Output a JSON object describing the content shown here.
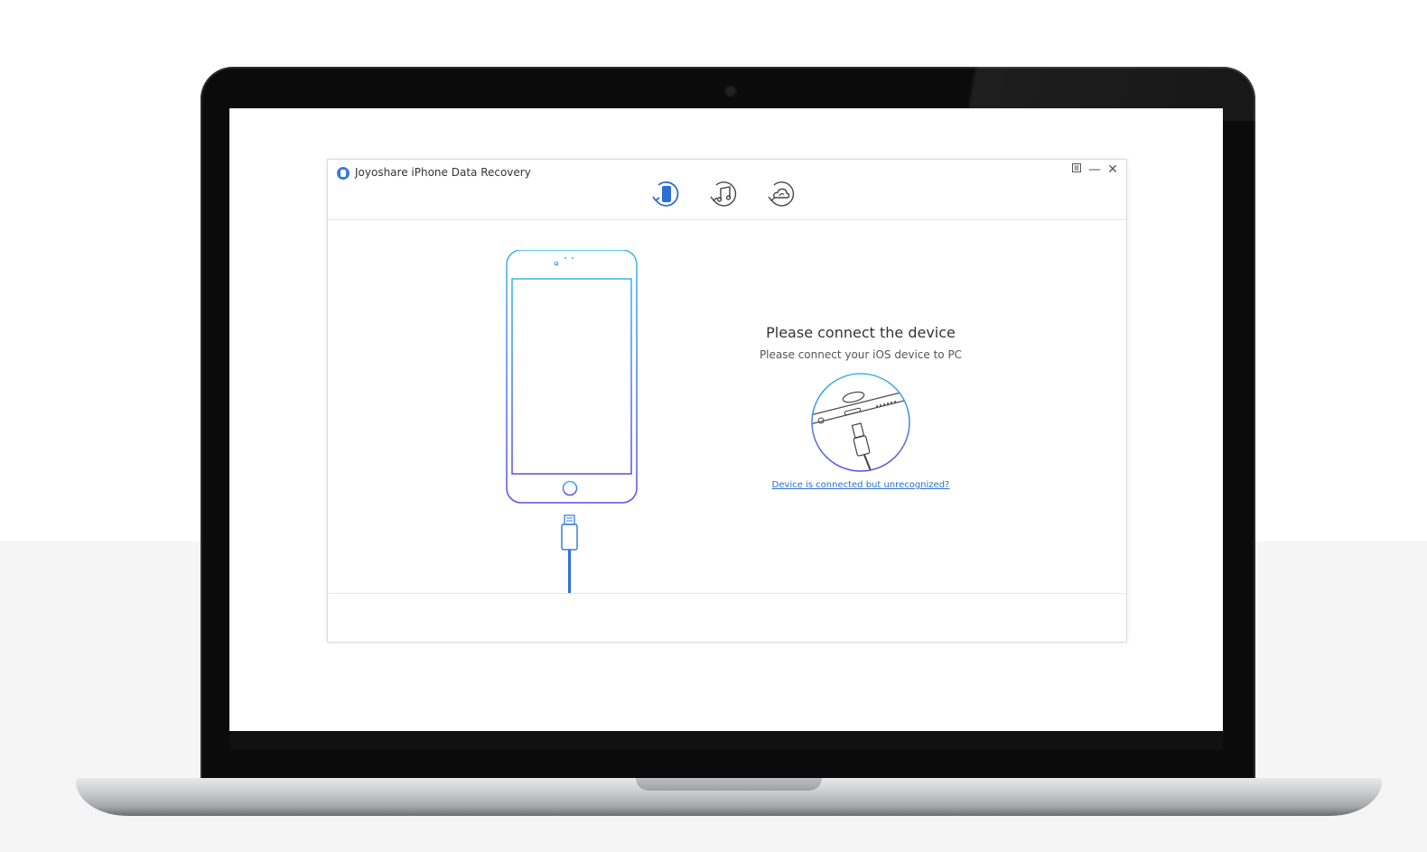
{
  "app": {
    "title": "Joyoshare iPhone Data Recovery"
  },
  "window_controls": {
    "menu_icon": "menu-icon",
    "minimize_label": "—",
    "close_label": "✕"
  },
  "mode_tabs": [
    {
      "name": "recover-from-ios-device",
      "icon": "iphone-restore-icon",
      "active": true
    },
    {
      "name": "recover-from-itunes",
      "icon": "itunes-restore-icon",
      "active": false
    },
    {
      "name": "recover-from-icloud",
      "icon": "icloud-restore-icon",
      "active": false
    }
  ],
  "main": {
    "title": "Please connect the device",
    "subtitle": "Please connect your iOS device to PC",
    "help_link": "Device is connected but unrecognized?"
  },
  "colors": {
    "accent": "#2a6ed6",
    "phone_gradient_start": "#38b6e8",
    "phone_gradient_end": "#5b4ee0"
  }
}
